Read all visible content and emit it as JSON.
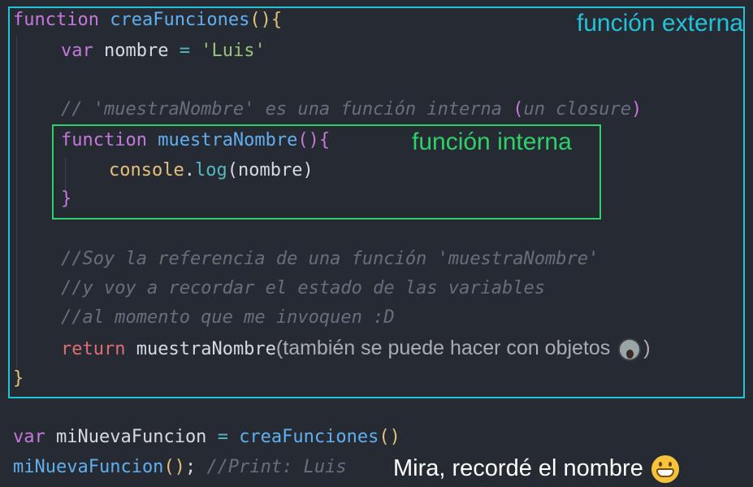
{
  "labels": {
    "outer": "función externa",
    "inner": "función interna"
  },
  "code": {
    "l1": {
      "kw": "function",
      "name": "creaFunciones",
      "parens": "()",
      "brace": "{"
    },
    "l2": {
      "kw": "var",
      "name": "nombre",
      "op": "=",
      "str": "'Luis'"
    },
    "l4": {
      "comment_a": "// 'muestraNombre' es una función interna ",
      "p_open": "(",
      "comment_b": "un closure",
      "p_close": ")"
    },
    "l5": {
      "kw": "function",
      "name": "muestraNombre",
      "parens": "()",
      "brace": "{"
    },
    "l6": {
      "obj": "console",
      "dot": ".",
      "method": "log",
      "p_open": "(",
      "arg": "nombre",
      "p_close": ")"
    },
    "l7": {
      "brace": "}"
    },
    "l9": {
      "comment": "//Soy la referencia de una función 'muestraNombre'"
    },
    "l10": {
      "comment": "//y voy a recordar el estado de las variables"
    },
    "l11": {
      "comment": "//al momento que me invoquen :D"
    },
    "l12": {
      "kw": "return",
      "name": "muestraNombre",
      "note_open": "(también se puede hacer con objetos ",
      "emoji": "scream-emoji",
      "note_close": ")"
    },
    "l13": {
      "brace": "}"
    },
    "l15": {
      "kw": "var",
      "name": "miNuevaFuncion",
      "op": "=",
      "call": "creaFunciones",
      "parens": "()"
    },
    "l16": {
      "name": "miNuevaFuncion",
      "parens": "()",
      "semi": ";",
      "comment": "//Print: Luis"
    }
  },
  "caption": {
    "text": "Mira, recordé el nombre",
    "emoji": "grin-emoji"
  },
  "colors": {
    "background": "#262b33",
    "outer_box": "#22c3d8",
    "inner_box": "#2fd06a"
  }
}
